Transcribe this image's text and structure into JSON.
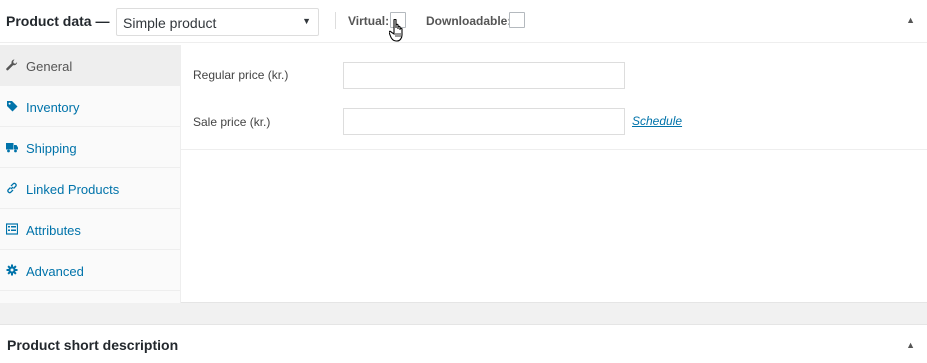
{
  "header": {
    "title": "Product data —",
    "product_type": "Simple product",
    "virtual_label": "Virtual:",
    "virtual_checked": false,
    "downloadable_label": "Downloadable:",
    "downloadable_checked": false,
    "collapse_icon": "triangle-up-icon"
  },
  "tabs": [
    {
      "label": "General",
      "icon": "wrench-icon",
      "active": true
    },
    {
      "label": "Inventory",
      "icon": "tag-icon",
      "active": false
    },
    {
      "label": "Shipping",
      "icon": "truck-icon",
      "active": false
    },
    {
      "label": "Linked Products",
      "icon": "link-icon",
      "active": false
    },
    {
      "label": "Attributes",
      "icon": "list-icon",
      "active": false
    },
    {
      "label": "Advanced",
      "icon": "gear-icon",
      "active": false
    }
  ],
  "general": {
    "regular_price_label": "Regular price (kr.)",
    "regular_price_value": "",
    "sale_price_label": "Sale price (kr.)",
    "sale_price_value": "",
    "schedule_link": "Schedule"
  },
  "short_description": {
    "title": "Product short description"
  },
  "colors": {
    "link": "#0073aa",
    "active_tab_bg": "#eeeeee",
    "border": "#dddddd"
  }
}
